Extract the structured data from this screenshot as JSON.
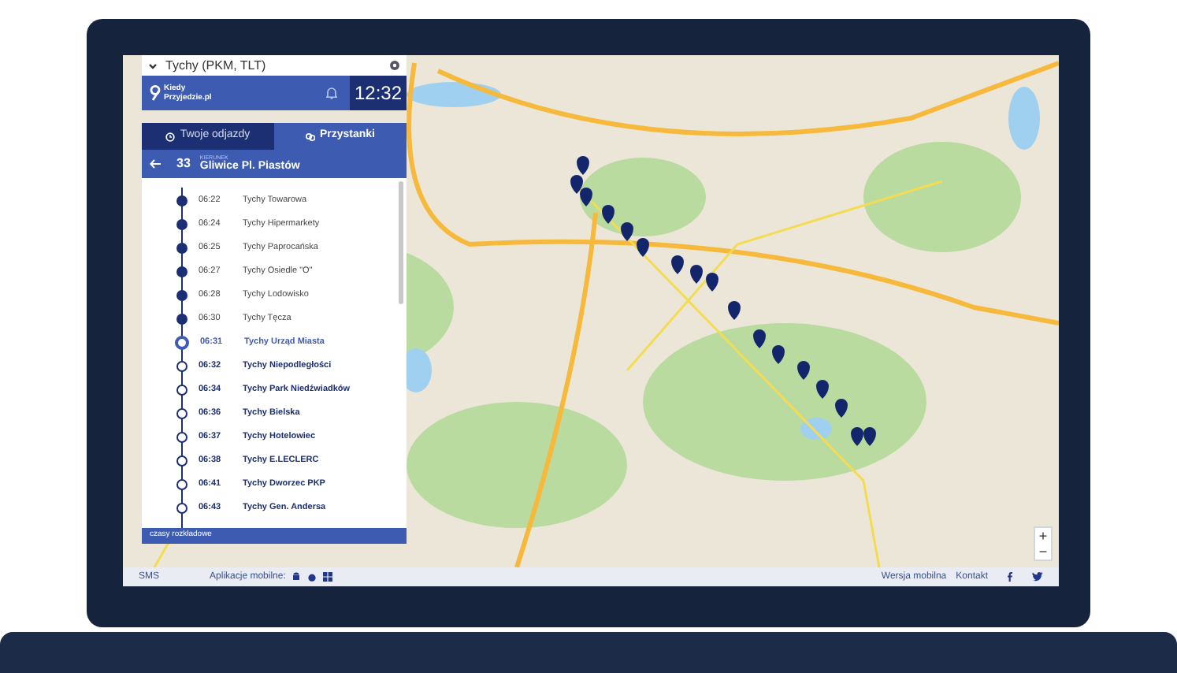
{
  "search": {
    "value": "Tychy (PKM, TLT)"
  },
  "header": {
    "logo_text": "Kiedy Przyjedzie.pl",
    "time": "12:32"
  },
  "tabs": [
    {
      "label": "Twoje odjazdy",
      "selected": false
    },
    {
      "label": "Przystanki",
      "selected": true
    }
  ],
  "route": {
    "line": "33",
    "direction_label": "KIERUNEK",
    "direction": "Gliwice Pl. Piastów"
  },
  "stops": [
    {
      "time": "06:22",
      "name": "Tychy Towarowa",
      "kind": "passed"
    },
    {
      "time": "06:24",
      "name": "Tychy Hipermarkety",
      "kind": "passed"
    },
    {
      "time": "06:25",
      "name": "Tychy Paprocańska",
      "kind": "passed"
    },
    {
      "time": "06:27",
      "name": "Tychy Osiedle \"O\"",
      "kind": "passed"
    },
    {
      "time": "06:28",
      "name": "Tychy Lodowisko",
      "kind": "passed"
    },
    {
      "time": "06:30",
      "name": "Tychy Tęcza",
      "kind": "passed"
    },
    {
      "time": "06:31",
      "name": "Tychy Urząd Miasta",
      "kind": "current"
    },
    {
      "time": "06:32",
      "name": "Tychy Niepodległości",
      "kind": "upcoming"
    },
    {
      "time": "06:34",
      "name": "Tychy Park Niedźwiadków",
      "kind": "upcoming"
    },
    {
      "time": "06:36",
      "name": "Tychy Bielska",
      "kind": "upcoming"
    },
    {
      "time": "06:37",
      "name": "Tychy Hotelowiec",
      "kind": "upcoming"
    },
    {
      "time": "06:38",
      "name": "Tychy E.LECLERC",
      "kind": "upcoming"
    },
    {
      "time": "06:41",
      "name": "Tychy Dworzec PKP",
      "kind": "upcoming"
    },
    {
      "time": "06:43",
      "name": "Tychy Gen. Andersa",
      "kind": "upcoming"
    }
  ],
  "panel_footer": "czasy rozkładowe",
  "map_controls": [
    "+",
    "−"
  ],
  "footer": {
    "left": [
      "SMS",
      "Aplikacje mobilne:"
    ],
    "right": [
      "Wersja mobilna",
      "Kontakt"
    ]
  }
}
